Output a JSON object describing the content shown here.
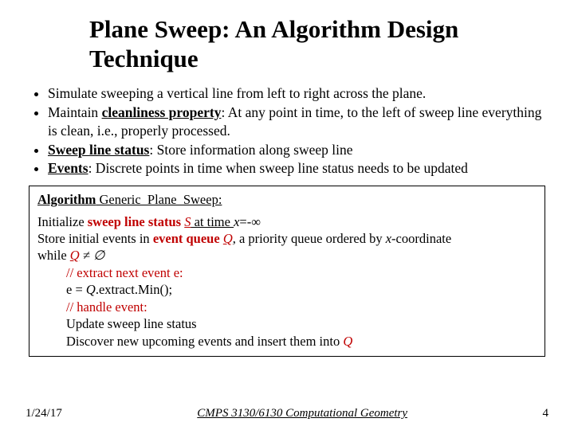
{
  "title": "Plane Sweep: An Algorithm Design Technique",
  "bullets": {
    "b0": "Simulate sweeping a vertical line from left to right across the plane.",
    "b1a": "Maintain ",
    "b1b": "cleanliness property",
    "b1c": ": At any point in time, to the left of sweep line everything is clean, i.e., properly processed.",
    "b2a": "Sweep line status",
    "b2b": ": Store information along sweep line",
    "b3a": "Events",
    "b3b": ": Discrete points in time when sweep line status needs to be updated"
  },
  "alg": {
    "head_a": "Algorithm",
    "head_b": " Generic_Plane_Sweep:",
    "l1a": "Initialize ",
    "l1b": "sweep line status",
    "l1c": " ",
    "l1d": "S",
    "l1e": " at time ",
    "l1f": "x",
    "l1g": "=-∞",
    "l2a": "Store initial events in ",
    "l2b": "event queue",
    "l2c": " ",
    "l2d": "Q",
    "l2e": ", a priority queue ordered by ",
    "l2f": "x",
    "l2g": "-coordinate",
    "l3a": "while ",
    "l3b": "Q",
    "l3c": " ≠ ∅",
    "l4": "// extract next event e:",
    "l5a": "e = ",
    "l5b": "Q",
    "l5c": ".extract.Min();",
    "l6": "// handle event:",
    "l7": "Update sweep line status",
    "l8a": "Discover new upcoming events and insert them into ",
    "l8b": "Q"
  },
  "footer": {
    "date": "1/24/17",
    "course": "CMPS 3130/6130 Computational Geometry",
    "page": "4"
  }
}
